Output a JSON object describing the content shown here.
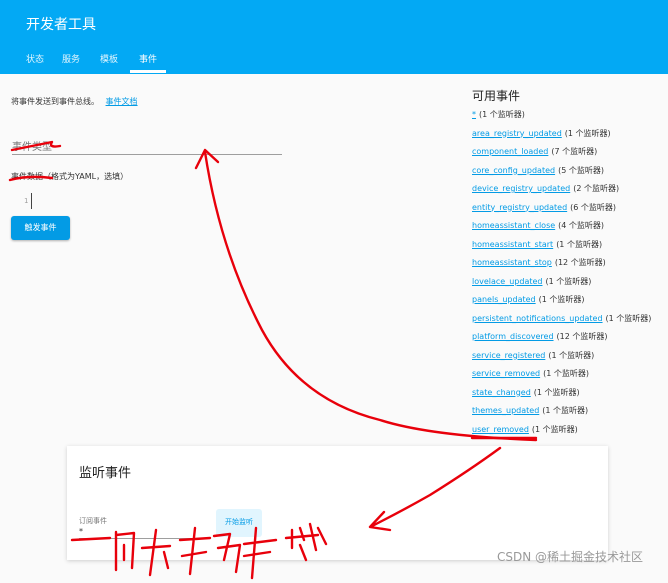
{
  "header": {
    "title": "开发者工具",
    "tabs": [
      {
        "label": "状态"
      },
      {
        "label": "服务"
      },
      {
        "label": "模板"
      },
      {
        "label": "事件",
        "active": true
      }
    ]
  },
  "fire_event": {
    "intro_text": "将事件发送到事件总线。",
    "docs_link": "事件文档",
    "event_type_placeholder": "事件类型",
    "event_data_label": "事件数据（格式为YAML，选填）",
    "line_number": "1",
    "fire_button": "触发事件"
  },
  "available_events": {
    "title": "可用事件",
    "items": [
      {
        "name": "*",
        "count": "(1 个监听器)"
      },
      {
        "name": "area_registry_updated",
        "count": "(1 个监听器)"
      },
      {
        "name": "component_loaded",
        "count": "(7 个监听器)"
      },
      {
        "name": "core_config_updated",
        "count": "(5 个监听器)"
      },
      {
        "name": "device_registry_updated",
        "count": "(2 个监听器)"
      },
      {
        "name": "entity_registry_updated",
        "count": "(6 个监听器)"
      },
      {
        "name": "homeassistant_close",
        "count": "(4 个监听器)"
      },
      {
        "name": "homeassistant_start",
        "count": "(1 个监听器)"
      },
      {
        "name": "homeassistant_stop",
        "count": "(12 个监听器)"
      },
      {
        "name": "lovelace_updated",
        "count": "(1 个监听器)"
      },
      {
        "name": "panels_updated",
        "count": "(1 个监听器)"
      },
      {
        "name": "persistent_notifications_updated",
        "count": "(1 个监听器)"
      },
      {
        "name": "platform_discovered",
        "count": "(12 个监听器)"
      },
      {
        "name": "service_registered",
        "count": "(1 个监听器)"
      },
      {
        "name": "service_removed",
        "count": "(1 个监听器)"
      },
      {
        "name": "state_changed",
        "count": "(1 个监听器)"
      },
      {
        "name": "themes_updated",
        "count": "(1 个监听器)"
      },
      {
        "name": "user_removed",
        "count": "(1 个监听器)"
      }
    ]
  },
  "listen": {
    "title": "监听事件",
    "subscribe_label": "订阅事件",
    "subscribe_value": "*",
    "start_button": "开始监听"
  },
  "watermark": "CSDN @稀土掘金技术社区",
  "colors": {
    "header_bg": "#03a9f4",
    "accent": "#039be5",
    "annotation_red": "#e8000b"
  }
}
